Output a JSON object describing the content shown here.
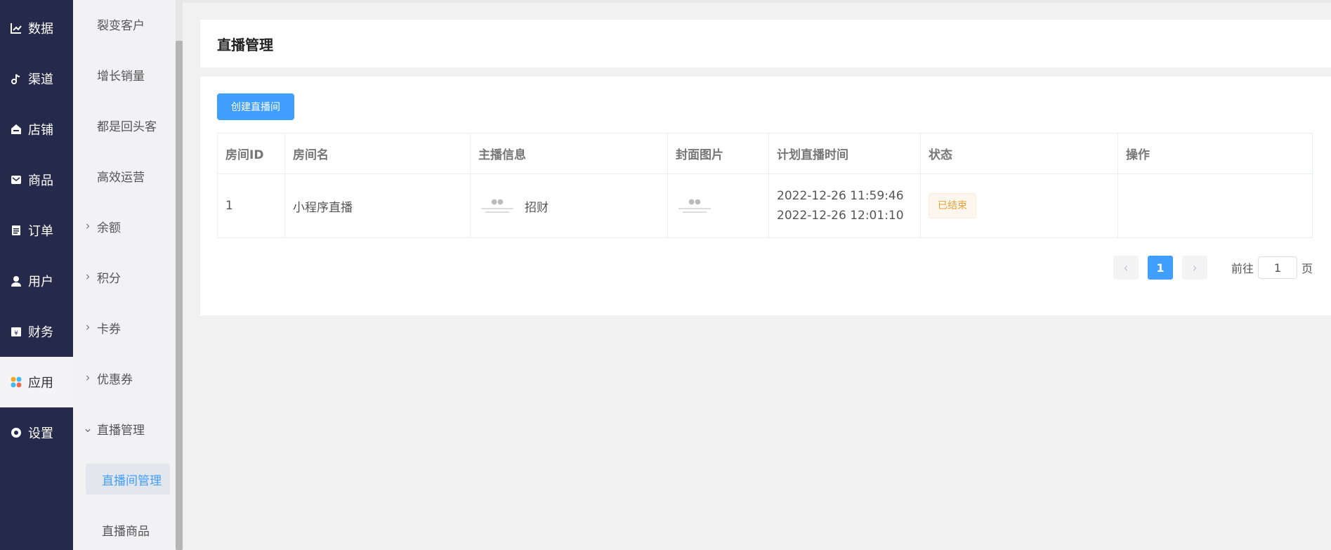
{
  "nav_primary": [
    {
      "label": "数据",
      "icon": "chart-line-icon"
    },
    {
      "label": "渠道",
      "icon": "music-note-icon"
    },
    {
      "label": "店铺",
      "icon": "store-icon"
    },
    {
      "label": "商品",
      "icon": "mail-icon"
    },
    {
      "label": "订单",
      "icon": "clipboard-icon"
    },
    {
      "label": "用户",
      "icon": "user-icon"
    },
    {
      "label": "财务",
      "icon": "finance-icon"
    },
    {
      "label": "应用",
      "icon": "apps-icon",
      "active": true
    },
    {
      "label": "设置",
      "icon": "settings-icon"
    }
  ],
  "nav_secondary": [
    {
      "label": "裂变客户"
    },
    {
      "label": "增长销量"
    },
    {
      "label": "都是回头客"
    },
    {
      "label": "高效运营"
    },
    {
      "label": "余额",
      "chevron": "right"
    },
    {
      "label": "积分",
      "chevron": "right"
    },
    {
      "label": "卡券",
      "chevron": "right"
    },
    {
      "label": "优惠券",
      "chevron": "right"
    },
    {
      "label": "直播管理",
      "chevron": "down"
    },
    {
      "label": "直播间管理",
      "active": true
    },
    {
      "label": "直播商品"
    }
  ],
  "page": {
    "title": "直播管理",
    "create_button": "创建直播间"
  },
  "table": {
    "headers": [
      "房间ID",
      "房间名",
      "主播信息",
      "封面图片",
      "计划直播时间",
      "状态",
      "操作"
    ],
    "rows": [
      {
        "id": "1",
        "name": "小程序直播",
        "anchor": "招财",
        "plan_start": "2022-12-26 11:59:46",
        "plan_end": "2022-12-26 12:01:10",
        "status": "已结束",
        "action": ""
      }
    ]
  },
  "pagination": {
    "current": "1",
    "goto_prefix": "前往",
    "goto_value": "1",
    "goto_suffix": "页"
  },
  "colors": {
    "nav_bg": "#262a4a",
    "primary": "#409eff",
    "status_warning": "#e6a23c"
  }
}
